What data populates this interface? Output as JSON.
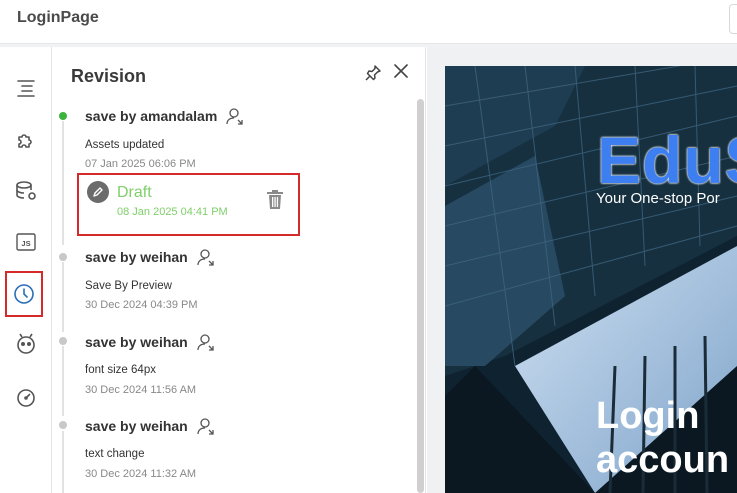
{
  "app": {
    "title": "LoginPage"
  },
  "panel": {
    "title": "Revision",
    "entries": [
      {
        "author": "save by amandalam",
        "message": "Assets updated",
        "time": "07 Jan 2025 06:06 PM"
      },
      {
        "author": "save by weihan",
        "message": "Save By Preview",
        "time": "30 Dec 2024 04:39 PM"
      },
      {
        "author": "save by weihan",
        "message": "font size 64px",
        "time": "30 Dec 2024 11:56 AM"
      },
      {
        "author": "save by weihan",
        "message": "text change",
        "time": "30 Dec 2024 11:32 AM"
      }
    ],
    "draft": {
      "label": "Draft",
      "time": "08 Jan 2025 04:41 PM"
    }
  },
  "preview": {
    "hero_title": "EduS",
    "hero_subtitle": "Your One-stop Por",
    "login_line1": "Login",
    "login_line2": "accoun"
  },
  "colors": {
    "accent_red": "#d42a2a",
    "active_dot": "#3cb43c",
    "draft_green": "#7fcf6a",
    "hero_blue": "#3d7ff0"
  }
}
